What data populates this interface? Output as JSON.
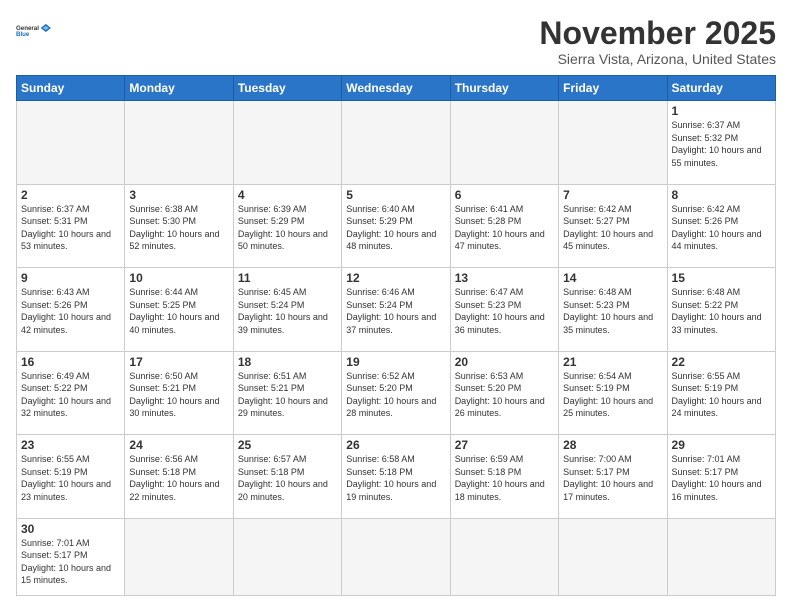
{
  "header": {
    "logo_general": "General",
    "logo_blue": "Blue",
    "month": "November 2025",
    "location": "Sierra Vista, Arizona, United States"
  },
  "days_of_week": [
    "Sunday",
    "Monday",
    "Tuesday",
    "Wednesday",
    "Thursday",
    "Friday",
    "Saturday"
  ],
  "weeks": [
    [
      {
        "day": "",
        "info": ""
      },
      {
        "day": "",
        "info": ""
      },
      {
        "day": "",
        "info": ""
      },
      {
        "day": "",
        "info": ""
      },
      {
        "day": "",
        "info": ""
      },
      {
        "day": "",
        "info": ""
      },
      {
        "day": "1",
        "info": "Sunrise: 6:37 AM\nSunset: 5:32 PM\nDaylight: 10 hours\nand 55 minutes."
      }
    ],
    [
      {
        "day": "2",
        "info": "Sunrise: 6:37 AM\nSunset: 5:31 PM\nDaylight: 10 hours\nand 53 minutes."
      },
      {
        "day": "3",
        "info": "Sunrise: 6:38 AM\nSunset: 5:30 PM\nDaylight: 10 hours\nand 52 minutes."
      },
      {
        "day": "4",
        "info": "Sunrise: 6:39 AM\nSunset: 5:29 PM\nDaylight: 10 hours\nand 50 minutes."
      },
      {
        "day": "5",
        "info": "Sunrise: 6:40 AM\nSunset: 5:29 PM\nDaylight: 10 hours\nand 48 minutes."
      },
      {
        "day": "6",
        "info": "Sunrise: 6:41 AM\nSunset: 5:28 PM\nDaylight: 10 hours\nand 47 minutes."
      },
      {
        "day": "7",
        "info": "Sunrise: 6:42 AM\nSunset: 5:27 PM\nDaylight: 10 hours\nand 45 minutes."
      },
      {
        "day": "8",
        "info": "Sunrise: 6:42 AM\nSunset: 5:26 PM\nDaylight: 10 hours\nand 44 minutes."
      }
    ],
    [
      {
        "day": "9",
        "info": "Sunrise: 6:43 AM\nSunset: 5:26 PM\nDaylight: 10 hours\nand 42 minutes."
      },
      {
        "day": "10",
        "info": "Sunrise: 6:44 AM\nSunset: 5:25 PM\nDaylight: 10 hours\nand 40 minutes."
      },
      {
        "day": "11",
        "info": "Sunrise: 6:45 AM\nSunset: 5:24 PM\nDaylight: 10 hours\nand 39 minutes."
      },
      {
        "day": "12",
        "info": "Sunrise: 6:46 AM\nSunset: 5:24 PM\nDaylight: 10 hours\nand 37 minutes."
      },
      {
        "day": "13",
        "info": "Sunrise: 6:47 AM\nSunset: 5:23 PM\nDaylight: 10 hours\nand 36 minutes."
      },
      {
        "day": "14",
        "info": "Sunrise: 6:48 AM\nSunset: 5:23 PM\nDaylight: 10 hours\nand 35 minutes."
      },
      {
        "day": "15",
        "info": "Sunrise: 6:48 AM\nSunset: 5:22 PM\nDaylight: 10 hours\nand 33 minutes."
      }
    ],
    [
      {
        "day": "16",
        "info": "Sunrise: 6:49 AM\nSunset: 5:22 PM\nDaylight: 10 hours\nand 32 minutes."
      },
      {
        "day": "17",
        "info": "Sunrise: 6:50 AM\nSunset: 5:21 PM\nDaylight: 10 hours\nand 30 minutes."
      },
      {
        "day": "18",
        "info": "Sunrise: 6:51 AM\nSunset: 5:21 PM\nDaylight: 10 hours\nand 29 minutes."
      },
      {
        "day": "19",
        "info": "Sunrise: 6:52 AM\nSunset: 5:20 PM\nDaylight: 10 hours\nand 28 minutes."
      },
      {
        "day": "20",
        "info": "Sunrise: 6:53 AM\nSunset: 5:20 PM\nDaylight: 10 hours\nand 26 minutes."
      },
      {
        "day": "21",
        "info": "Sunrise: 6:54 AM\nSunset: 5:19 PM\nDaylight: 10 hours\nand 25 minutes."
      },
      {
        "day": "22",
        "info": "Sunrise: 6:55 AM\nSunset: 5:19 PM\nDaylight: 10 hours\nand 24 minutes."
      }
    ],
    [
      {
        "day": "23",
        "info": "Sunrise: 6:55 AM\nSunset: 5:19 PM\nDaylight: 10 hours\nand 23 minutes."
      },
      {
        "day": "24",
        "info": "Sunrise: 6:56 AM\nSunset: 5:18 PM\nDaylight: 10 hours\nand 22 minutes."
      },
      {
        "day": "25",
        "info": "Sunrise: 6:57 AM\nSunset: 5:18 PM\nDaylight: 10 hours\nand 20 minutes."
      },
      {
        "day": "26",
        "info": "Sunrise: 6:58 AM\nSunset: 5:18 PM\nDaylight: 10 hours\nand 19 minutes."
      },
      {
        "day": "27",
        "info": "Sunrise: 6:59 AM\nSunset: 5:18 PM\nDaylight: 10 hours\nand 18 minutes."
      },
      {
        "day": "28",
        "info": "Sunrise: 7:00 AM\nSunset: 5:17 PM\nDaylight: 10 hours\nand 17 minutes."
      },
      {
        "day": "29",
        "info": "Sunrise: 7:01 AM\nSunset: 5:17 PM\nDaylight: 10 hours\nand 16 minutes."
      }
    ],
    [
      {
        "day": "30",
        "info": "Sunrise: 7:01 AM\nSunset: 5:17 PM\nDaylight: 10 hours\nand 15 minutes."
      },
      {
        "day": "",
        "info": ""
      },
      {
        "day": "",
        "info": ""
      },
      {
        "day": "",
        "info": ""
      },
      {
        "day": "",
        "info": ""
      },
      {
        "day": "",
        "info": ""
      },
      {
        "day": "",
        "info": ""
      }
    ]
  ]
}
